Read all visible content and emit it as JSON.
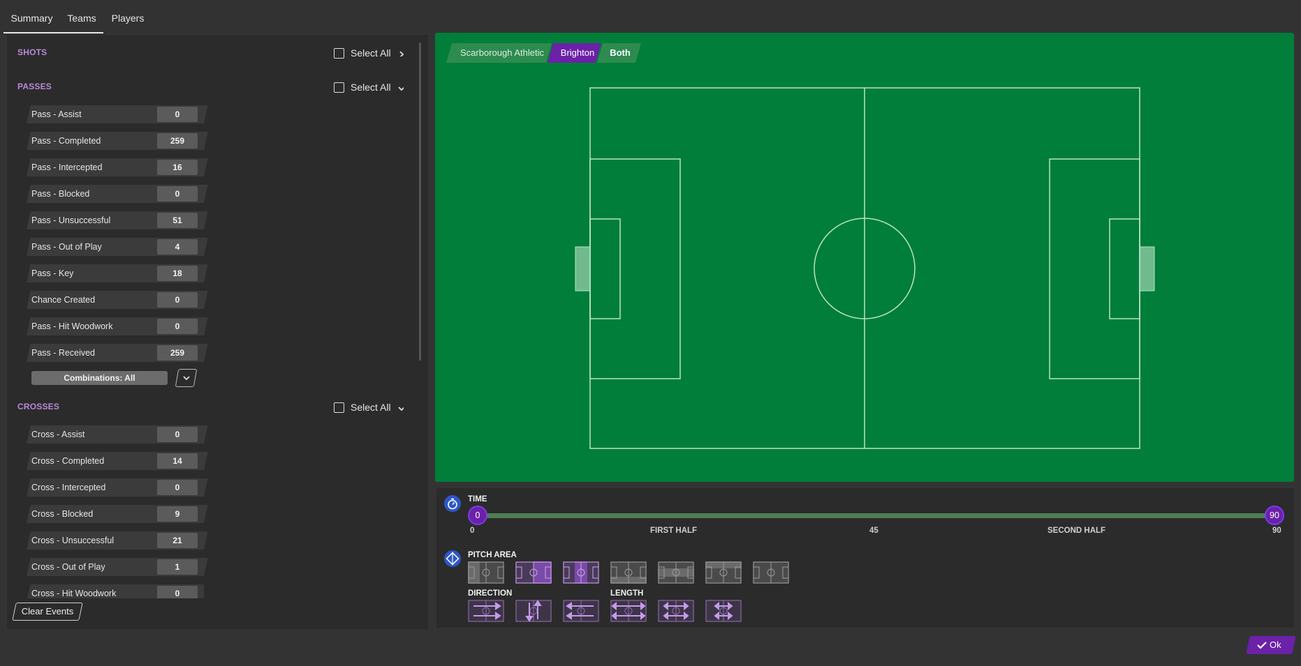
{
  "tabs": [
    {
      "label": "Summary",
      "active": true
    },
    {
      "label": "Teams",
      "active": false
    },
    {
      "label": "Players",
      "active": false
    }
  ],
  "sections": {
    "shots": {
      "title": "SHOTS",
      "select_all": "Select All"
    },
    "passes": {
      "title": "PASSES",
      "select_all": "Select All",
      "rows": [
        {
          "label": "Pass - Assist",
          "value": "0"
        },
        {
          "label": "Pass - Completed",
          "value": "259"
        },
        {
          "label": "Pass - Intercepted",
          "value": "16"
        },
        {
          "label": "Pass - Blocked",
          "value": "0"
        },
        {
          "label": "Pass - Unsuccessful",
          "value": "51"
        },
        {
          "label": "Pass - Out of Play",
          "value": "4"
        },
        {
          "label": "Pass - Key",
          "value": "18"
        },
        {
          "label": "Chance Created",
          "value": "0"
        },
        {
          "label": "Pass - Hit Woodwork",
          "value": "0"
        },
        {
          "label": "Pass - Received",
          "value": "259"
        }
      ],
      "combinations": "Combinations: All"
    },
    "crosses": {
      "title": "CROSSES",
      "select_all": "Select All",
      "rows": [
        {
          "label": "Cross - Assist",
          "value": "0"
        },
        {
          "label": "Cross - Completed",
          "value": "14"
        },
        {
          "label": "Cross - Intercepted",
          "value": "0"
        },
        {
          "label": "Cross - Blocked",
          "value": "9"
        },
        {
          "label": "Cross - Unsuccessful",
          "value": "21"
        },
        {
          "label": "Cross - Out of Play",
          "value": "1"
        },
        {
          "label": "Cross - Hit Woodwork",
          "value": "0"
        }
      ]
    }
  },
  "clear_events": "Clear Events",
  "team_tabs": [
    {
      "label": "Scarborough Athletic",
      "active": false
    },
    {
      "label": "Brighton",
      "active": true
    },
    {
      "label": "Both",
      "active": false
    }
  ],
  "time": {
    "title": "TIME",
    "min": "0",
    "max": "90",
    "ticks": [
      "0",
      "FIRST HALF",
      "45",
      "SECOND HALF",
      "90"
    ]
  },
  "pitch_area": {
    "title": "PITCH AREA"
  },
  "direction": {
    "title": "DIRECTION"
  },
  "length": {
    "title": "LENGTH"
  },
  "ok": "Ok",
  "colors": {
    "accent_purple": "#6b21a8",
    "section_title": "#b98ad6",
    "pitch_green": "#007e3a",
    "track_green": "#4f7f55",
    "icon_blue": "#2c57c7"
  }
}
